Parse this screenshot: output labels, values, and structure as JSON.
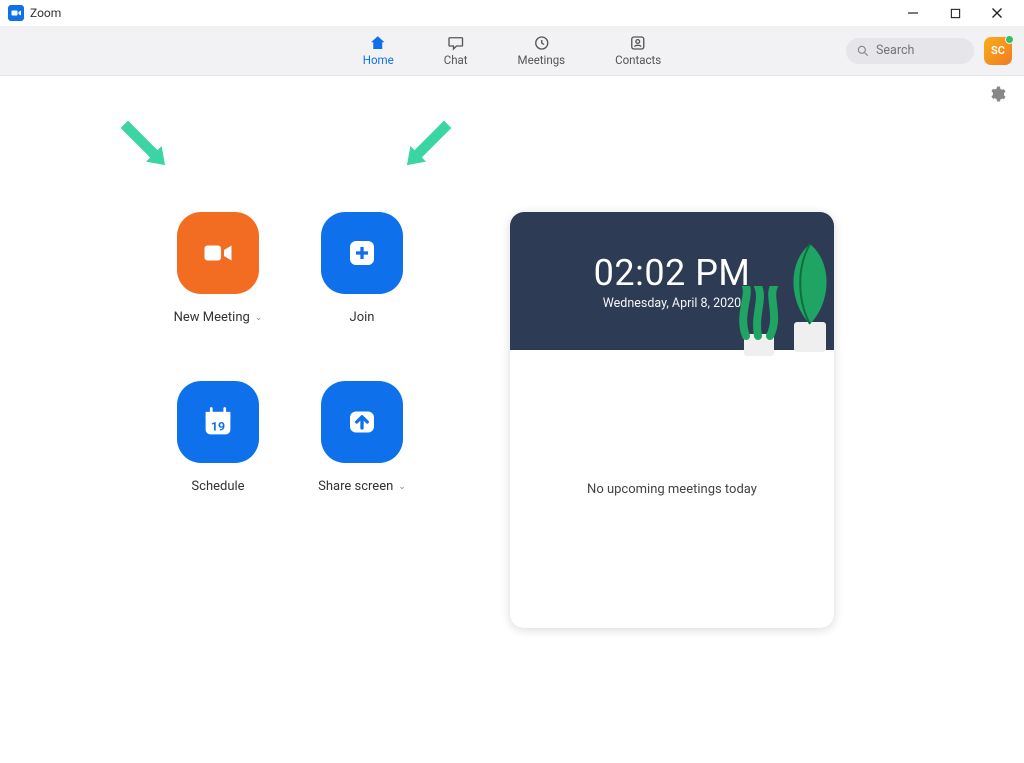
{
  "titlebar": {
    "app_name": "Zoom"
  },
  "nav": {
    "home": "Home",
    "chat": "Chat",
    "meetings": "Meetings",
    "contacts": "Contacts"
  },
  "search": {
    "placeholder": "Search"
  },
  "avatar": {
    "initials": "SC"
  },
  "actions": {
    "new_meeting": "New Meeting",
    "join": "Join",
    "schedule": "Schedule",
    "schedule_day": "19",
    "share_screen": "Share screen"
  },
  "panel": {
    "time": "02:02 PM",
    "date": "Wednesday, April 8, 2020",
    "empty_msg": "No upcoming meetings today"
  },
  "colors": {
    "accent_blue": "#0e71eb",
    "accent_orange": "#f26d21"
  }
}
